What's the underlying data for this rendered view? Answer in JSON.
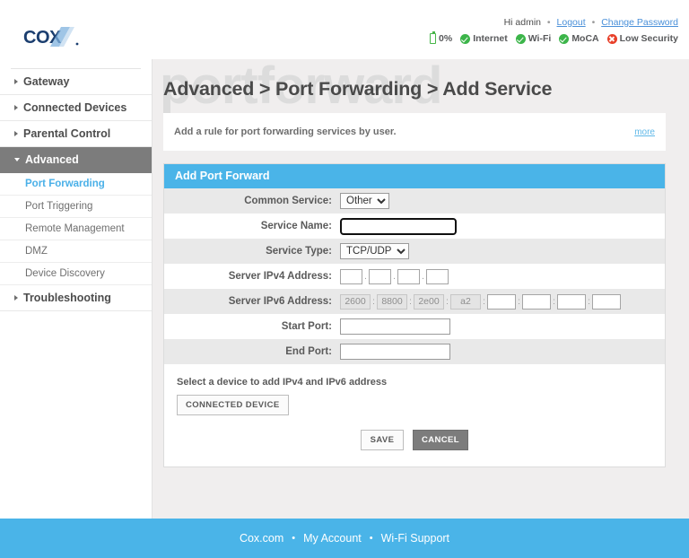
{
  "header": {
    "logo_text": "COX",
    "greeting": "Hi admin",
    "logout_label": "Logout",
    "change_password_label": "Change Password",
    "separator": "•",
    "status": [
      {
        "icon": "battery-icon",
        "label": "0%",
        "state": "ok"
      },
      {
        "icon": "check-circle-icon",
        "label": "Internet",
        "state": "ok"
      },
      {
        "icon": "check-circle-icon",
        "label": "Wi-Fi",
        "state": "ok"
      },
      {
        "icon": "check-circle-icon",
        "label": "MoCA",
        "state": "ok"
      },
      {
        "icon": "x-circle-icon",
        "label": "Low Security",
        "state": "bad"
      }
    ]
  },
  "sidebar": {
    "items": [
      {
        "label": "Gateway",
        "type": "top",
        "state": "collapsed"
      },
      {
        "label": "Connected Devices",
        "type": "top",
        "state": "collapsed"
      },
      {
        "label": "Parental Control",
        "type": "top",
        "state": "collapsed"
      },
      {
        "label": "Advanced",
        "type": "top",
        "state": "expanded-active"
      },
      {
        "label": "Port Forwarding",
        "type": "sub",
        "state": "selected"
      },
      {
        "label": "Port Triggering",
        "type": "sub",
        "state": "normal"
      },
      {
        "label": "Remote Management",
        "type": "sub",
        "state": "normal"
      },
      {
        "label": "DMZ",
        "type": "sub",
        "state": "normal"
      },
      {
        "label": "Device Discovery",
        "type": "sub",
        "state": "normal"
      },
      {
        "label": "Troubleshooting",
        "type": "top",
        "state": "collapsed"
      }
    ]
  },
  "content": {
    "watermark": "portforward",
    "page_title": "Advanced > Port Forwarding > Add Service",
    "info_text": "Add a rule for port forwarding services by user.",
    "more_label": "more"
  },
  "panel": {
    "title": "Add Port Forward",
    "fields": {
      "common_service": {
        "label": "Common Service:",
        "value": "Other",
        "options": [
          "Other"
        ]
      },
      "service_name": {
        "label": "Service Name:",
        "value": "",
        "focused": true
      },
      "service_type": {
        "label": "Service Type:",
        "value": "TCP/UDP",
        "options": [
          "TCP/UDP"
        ]
      },
      "server_ipv4": {
        "label": "Server IPv4 Address:",
        "octets": [
          "",
          "",
          "",
          ""
        ],
        "separator": "."
      },
      "server_ipv6": {
        "label": "Server IPv6 Address:",
        "prefix_groups": [
          "2600",
          "8800",
          "2e00",
          "a2"
        ],
        "editable_groups": [
          "",
          "",
          "",
          ""
        ],
        "separator": ":"
      },
      "start_port": {
        "label": "Start Port:",
        "value": ""
      },
      "end_port": {
        "label": "End Port:",
        "value": ""
      }
    },
    "select_device_note": "Select a device to add IPv4 and IPv6 address",
    "connected_device_label": "CONNECTED DEVICE",
    "save_label": "SAVE",
    "cancel_label": "CANCEL"
  },
  "footer": {
    "links": [
      "Cox.com",
      "My Account",
      "Wi-Fi Support"
    ],
    "separator": "•"
  },
  "colors": {
    "accent_blue": "#4ab4e8",
    "active_gray": "#7c7c7c",
    "link_blue": "#4a90d9",
    "ok_green": "#3cb54a",
    "bad_red": "#e8402a",
    "focus_purple": "#7b68c8"
  }
}
